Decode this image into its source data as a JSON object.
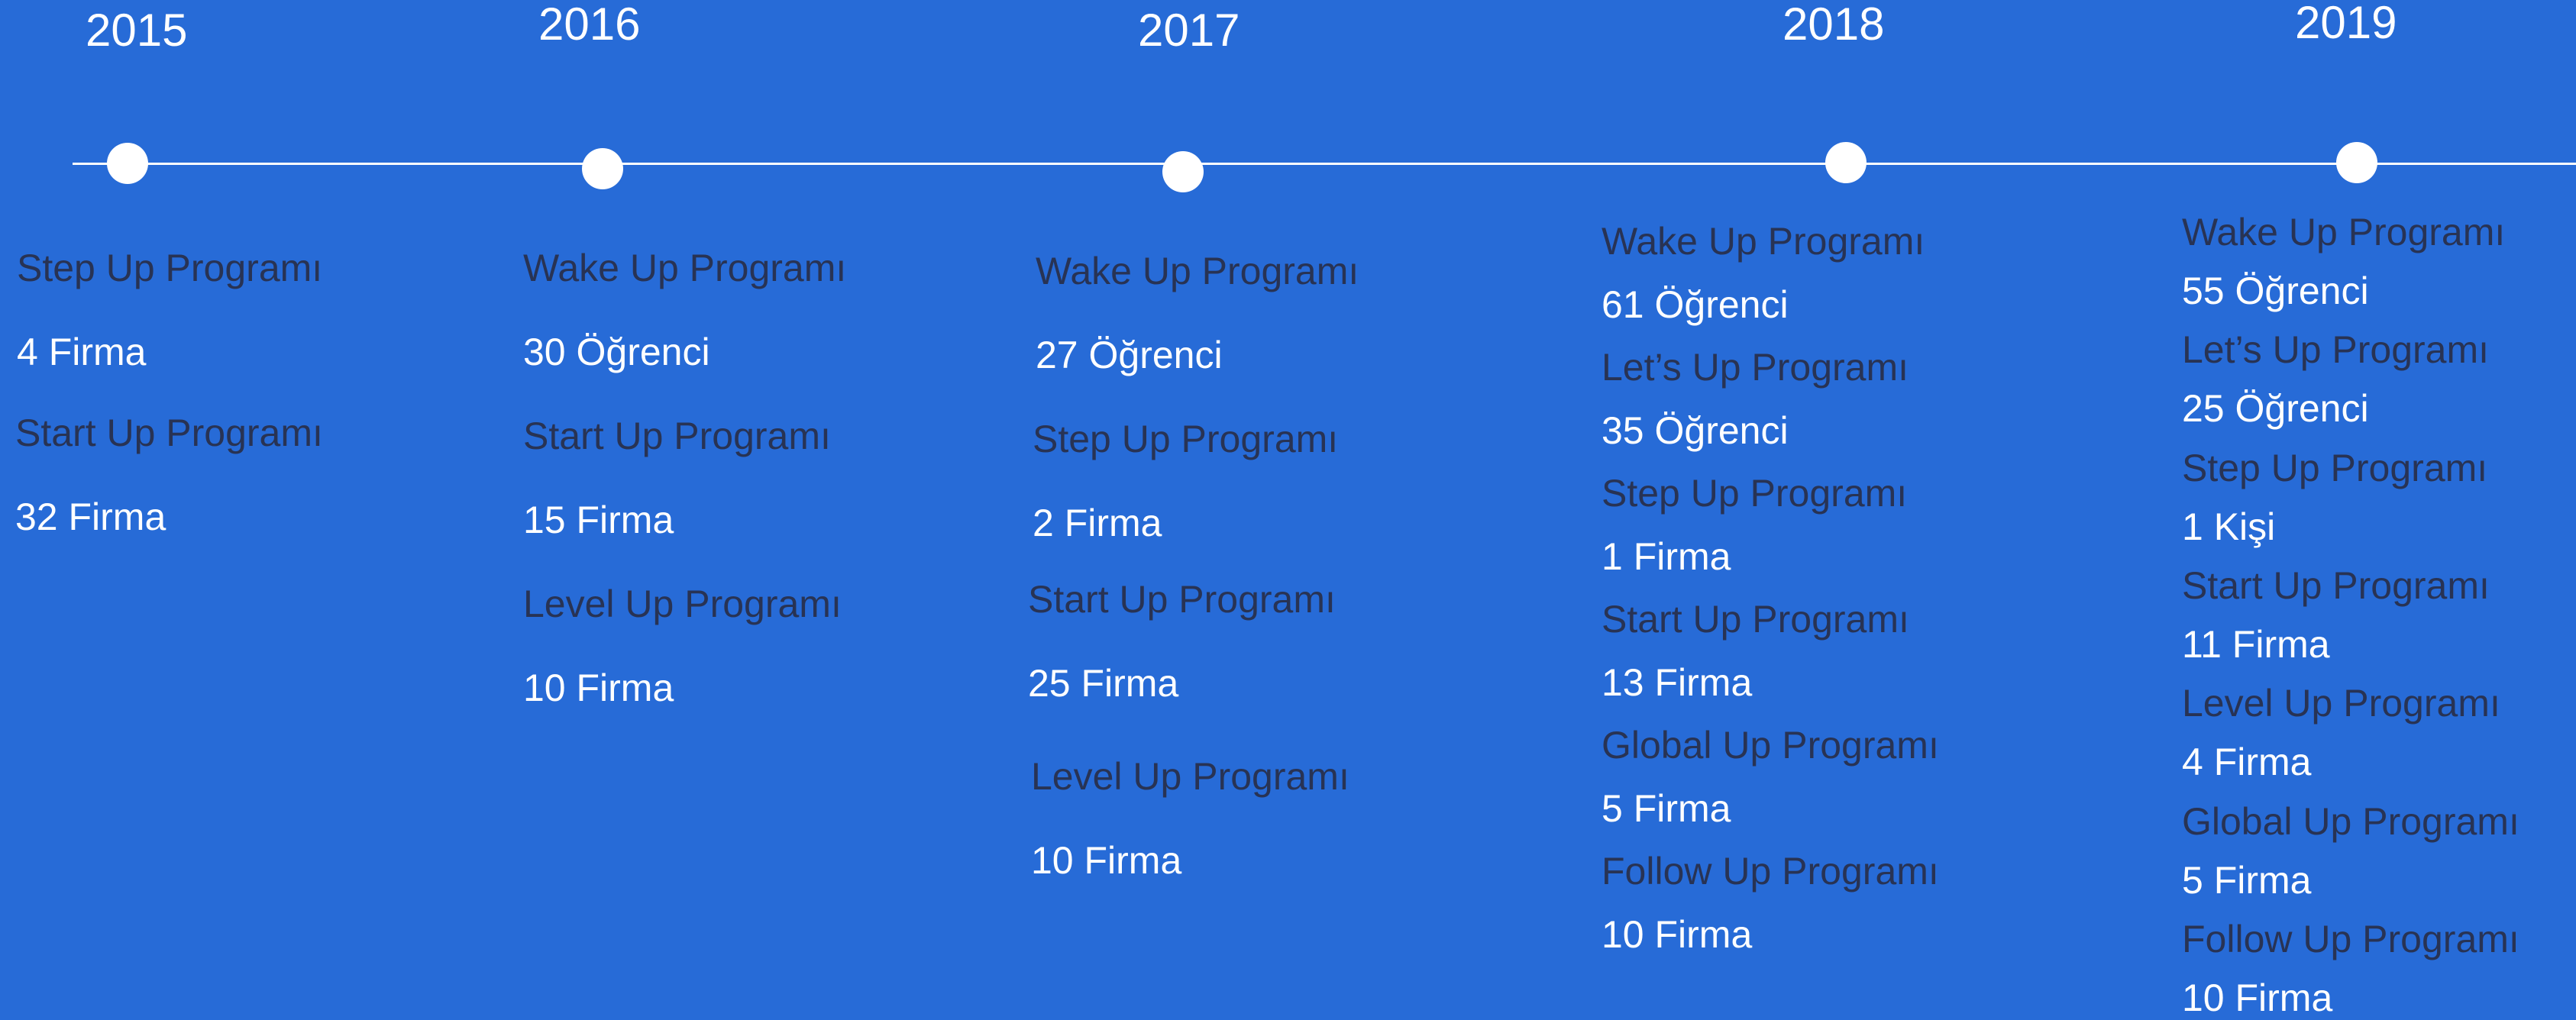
{
  "colors": {
    "background": "#276bd7",
    "timeline": "#ffffff",
    "program_text": "#283354",
    "count_text": "#ffffff"
  },
  "years": [
    {
      "year": "2015",
      "entries": [
        {
          "program": "Step Up Programı",
          "count": "4 Firma"
        },
        {
          "program": "Start Up Programı",
          "count": "32 Firma"
        }
      ]
    },
    {
      "year": "2016",
      "entries": [
        {
          "program": "Wake Up Programı",
          "count": "30 Öğrenci"
        },
        {
          "program": "Start Up Programı",
          "count": "15 Firma"
        },
        {
          "program": "Level Up Programı",
          "count": "10 Firma"
        }
      ]
    },
    {
      "year": "2017",
      "entries": [
        {
          "program": "Wake Up Programı",
          "count": "27 Öğrenci"
        },
        {
          "program": "Step Up Programı",
          "count": "2 Firma"
        },
        {
          "program": "Start Up Programı",
          "count": "25 Firma"
        },
        {
          "program": "Level Up Programı",
          "count": "10 Firma"
        }
      ]
    },
    {
      "year": "2018",
      "entries": [
        {
          "program": "Wake Up Programı",
          "count": "61 Öğrenci"
        },
        {
          "program": "Let’s Up Programı",
          "count": "35 Öğrenci"
        },
        {
          "program": "Step Up Programı",
          "count": "1 Firma"
        },
        {
          "program": "Start Up Programı",
          "count": "13 Firma"
        },
        {
          "program": "Global Up Programı",
          "count": "5 Firma"
        },
        {
          "program": "Follow Up Programı",
          "count": "10 Firma"
        }
      ]
    },
    {
      "year": "2019",
      "entries": [
        {
          "program": "Wake Up Programı",
          "count": "55 Öğrenci"
        },
        {
          "program": "Let’s Up Programı",
          "count": "25 Öğrenci"
        },
        {
          "program": "Step Up Programı",
          "count": "1 Kişi"
        },
        {
          "program": "Start Up Programı",
          "count": "11 Firma"
        },
        {
          "program": "Level Up Programı",
          "count": "4 Firma"
        },
        {
          "program": "Global Up Programı",
          "count": "5 Firma"
        },
        {
          "program": "Follow Up Programı",
          "count": "10 Firma"
        }
      ]
    }
  ]
}
